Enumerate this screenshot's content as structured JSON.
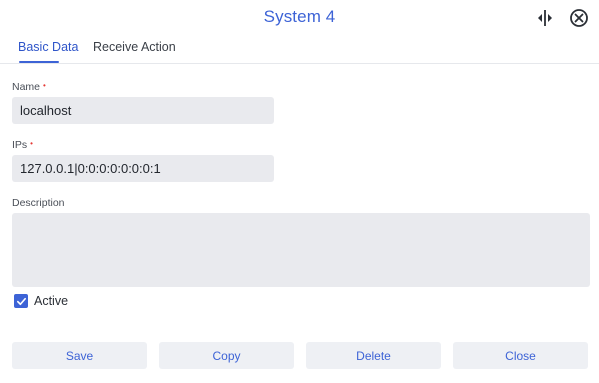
{
  "window": {
    "title": "System 4",
    "split_icon": "split-view-icon",
    "close_icon": "close-circle-icon"
  },
  "tabs": [
    {
      "label": "Basic Data",
      "active": true
    },
    {
      "label": "Receive Action",
      "active": false
    }
  ],
  "form": {
    "name": {
      "label": "Name",
      "required_marker": "•",
      "value": "localhost"
    },
    "ips": {
      "label": "IPs",
      "required_marker": "•",
      "value": "127.0.0.1|0:0:0:0:0:0:0:1"
    },
    "description": {
      "label": "Description",
      "value": ""
    },
    "active": {
      "label": "Active",
      "checked": true
    }
  },
  "buttons": {
    "save": "Save",
    "copy": "Copy",
    "delete": "Delete",
    "close": "Close"
  },
  "colors": {
    "accent": "#3d63d6",
    "required": "#e53935",
    "field_bg": "#e9eaee",
    "button_bg": "#eef0f4"
  }
}
